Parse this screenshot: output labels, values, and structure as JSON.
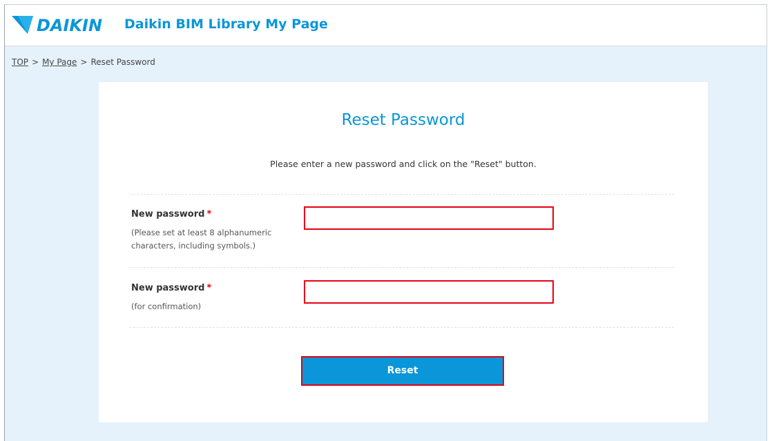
{
  "header": {
    "logo_text": "DAIKIN",
    "site_title": "Daikin BIM Library My Page",
    "brand_color": "#0a96d8"
  },
  "breadcrumb": {
    "items": [
      {
        "label": "TOP"
      },
      {
        "label": "My Page"
      },
      {
        "label": "Reset Password"
      }
    ],
    "separator": ">"
  },
  "form": {
    "title": "Reset Password",
    "instruction": "Please enter a new password and click on the \"Reset\" button.",
    "required_mark": "*",
    "fields": [
      {
        "label": "New password",
        "hint": "(Please set at least 8 alphanumeric characters, including symbols.)",
        "value": "",
        "placeholder": ""
      },
      {
        "label": "New password",
        "hint": "(for confirmation)",
        "value": "",
        "placeholder": ""
      }
    ],
    "submit_label": "Reset"
  },
  "colors": {
    "accent": "#0a96d8",
    "required": "#e60012",
    "highlight_border": "#e60012",
    "page_background": "#e6f2fb"
  }
}
